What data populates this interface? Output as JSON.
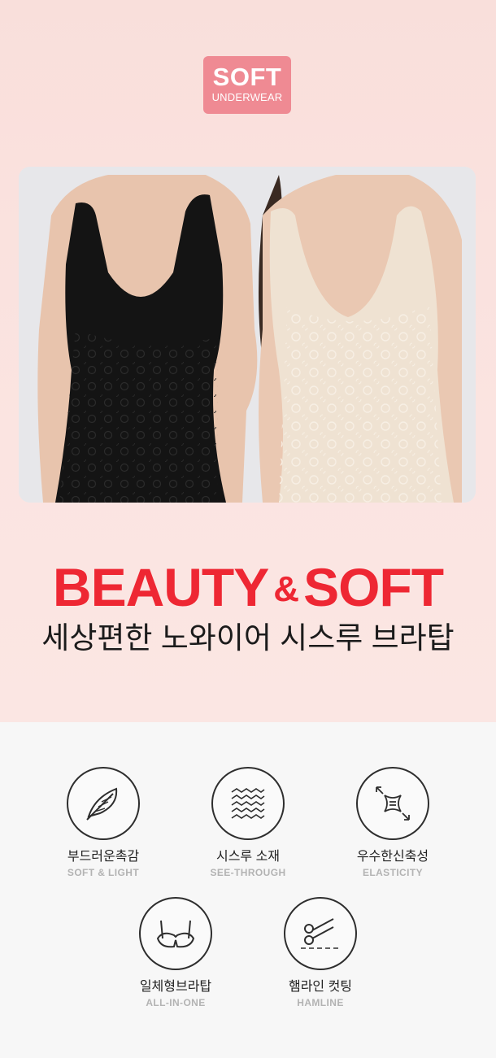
{
  "badge": {
    "title": "SOFT",
    "subtitle": "UNDERWEAR"
  },
  "hero": {
    "headline_part1": "BEAUTY",
    "headline_amp": "&",
    "headline_part2": "SOFT",
    "subline": "세상편한 노와이어 시스루 브라탑"
  },
  "features": [
    {
      "icon": "feather-icon",
      "ko": "부드러운촉감",
      "en": "SOFT & LIGHT"
    },
    {
      "icon": "mesh-texture-icon",
      "ko": "시스루 소재",
      "en": "SEE-THROUGH"
    },
    {
      "icon": "stretch-arrows-icon",
      "ko": "우수한신축성",
      "en": "ELASTICITY"
    },
    {
      "icon": "bra-icon",
      "ko": "일체형브라탑",
      "en": "ALL-IN-ONE"
    },
    {
      "icon": "scissors-icon",
      "ko": "햄라인 컷팅",
      "en": "HAMLINE"
    }
  ],
  "colors": {
    "badge": "#ef8a93",
    "headline": "#ee2733",
    "pink_bg": "#fbe4e1",
    "black_product": "#141414",
    "beige_product": "#efe2d2"
  }
}
